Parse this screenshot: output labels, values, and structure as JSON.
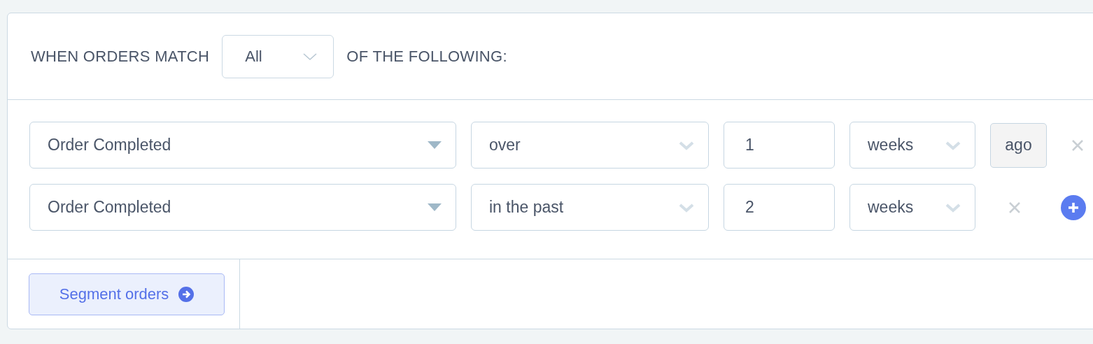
{
  "header": {
    "prefix": "WHEN ORDERS MATCH",
    "match": "All",
    "suffix": "OF THE FOLLOWING:"
  },
  "conditions": [
    {
      "field": "Order Completed",
      "operator": "over",
      "value": "1",
      "unit": "weeks",
      "suffix": "ago"
    },
    {
      "field": "Order Completed",
      "operator": "in the past",
      "value": "2",
      "unit": "weeks"
    }
  ],
  "submit_button": "Segment orders"
}
